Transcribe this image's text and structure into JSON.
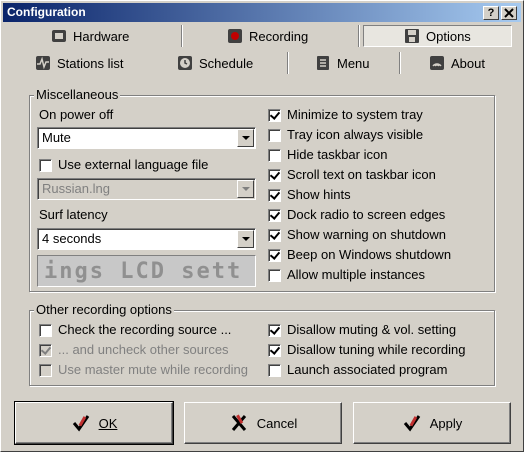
{
  "window": {
    "title": "Configuration",
    "help_btn": "?",
    "close_btn": "X"
  },
  "tabs_row1": [
    {
      "label": "Hardware",
      "icon": "hardware-icon"
    },
    {
      "label": "Recording",
      "icon": "recording-icon"
    },
    {
      "label": "Options",
      "icon": "options-icon",
      "active": true
    }
  ],
  "tabs_row2": [
    {
      "label": "Stations list",
      "icon": "stations-icon"
    },
    {
      "label": "Schedule",
      "icon": "schedule-icon"
    },
    {
      "label": "Menu",
      "icon": "menu-icon"
    },
    {
      "label": "About",
      "icon": "about-icon"
    }
  ],
  "misc": {
    "title": "Miscellaneous",
    "power_off_label": "On power off",
    "power_off_value": "Mute",
    "ext_lang_label": "Use external language file",
    "ext_lang_checked": false,
    "lang_file_value": "Russian.lng",
    "surf_latency_label": "Surf latency",
    "surf_latency_value": "4 seconds",
    "lcd_text": "ings LCD sett",
    "options": [
      {
        "label": "Minimize to system tray",
        "checked": true
      },
      {
        "label": "Tray icon always visible",
        "checked": false
      },
      {
        "label": "Hide taskbar icon",
        "checked": false
      },
      {
        "label": "Scroll text on taskbar icon",
        "checked": true
      },
      {
        "label": "Show hints",
        "checked": true
      },
      {
        "label": "Dock radio to screen edges",
        "checked": true
      },
      {
        "label": "Show warning on shutdown",
        "checked": true
      },
      {
        "label": "Beep on Windows shutdown",
        "checked": true
      },
      {
        "label": "Allow multiple instances",
        "checked": false
      }
    ]
  },
  "recording": {
    "title": "Other recording options",
    "left": [
      {
        "label": "Check the recording source ...",
        "checked": false,
        "disabled": false
      },
      {
        "label": "... and uncheck other sources",
        "checked": true,
        "disabled": true
      },
      {
        "label": "Use master mute while recording",
        "checked": false,
        "disabled": true
      }
    ],
    "right": [
      {
        "label": "Disallow muting & vol. setting",
        "checked": true
      },
      {
        "label": "Disallow tuning while recording",
        "checked": true
      },
      {
        "label": "Launch associated program",
        "checked": false
      }
    ]
  },
  "buttons": {
    "ok": "OK",
    "cancel": "Cancel",
    "apply": "Apply"
  },
  "colors": {
    "face": "#d4d0c8",
    "title_start": "#0a246a",
    "title_end": "#a6caf0"
  }
}
